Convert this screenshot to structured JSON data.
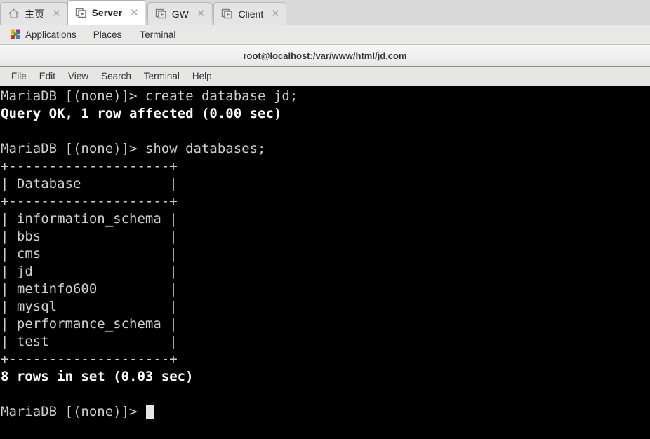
{
  "tabstrip": {
    "tabs": [
      {
        "label": "主页",
        "icon": "home-icon",
        "active": false,
        "close_label": "✕"
      },
      {
        "label": "Server",
        "icon": "window-play-icon",
        "active": true,
        "close_label": "✕"
      },
      {
        "label": "GW",
        "icon": "window-play-icon",
        "active": false,
        "close_label": "✕"
      },
      {
        "label": "Client",
        "icon": "window-play-icon",
        "active": false,
        "close_label": "✕"
      }
    ]
  },
  "gnome_panel": {
    "applications_label": "Applications",
    "places_label": "Places",
    "terminal_label": "Terminal"
  },
  "terminal": {
    "title": "root@localhost:/var/www/html/jd.com",
    "menu": [
      "File",
      "Edit",
      "View",
      "Search",
      "Terminal",
      "Help"
    ],
    "colors": {
      "background": "#000000",
      "foreground": "#cfcfcf",
      "bold_foreground": "#ffffff",
      "cursor": "#e6e6e6"
    },
    "lines": [
      {
        "text": "MariaDB [(none)]> create database jd;",
        "bold": false
      },
      {
        "text": "Query OK, 1 row affected (0.00 sec)",
        "bold": true
      },
      {
        "text": "",
        "bold": false
      },
      {
        "text": "MariaDB [(none)]> show databases;",
        "bold": false
      },
      {
        "text": "+--------------------+",
        "bold": false
      },
      {
        "text": "| Database           |",
        "bold": false
      },
      {
        "text": "+--------------------+",
        "bold": false
      },
      {
        "text": "| information_schema |",
        "bold": false
      },
      {
        "text": "| bbs                |",
        "bold": false
      },
      {
        "text": "| cms                |",
        "bold": false
      },
      {
        "text": "| jd                 |",
        "bold": false
      },
      {
        "text": "| metinfo600         |",
        "bold": false
      },
      {
        "text": "| mysql              |",
        "bold": false
      },
      {
        "text": "| performance_schema |",
        "bold": false
      },
      {
        "text": "| test               |",
        "bold": false
      },
      {
        "text": "+--------------------+",
        "bold": false
      },
      {
        "text": "8 rows in set (0.03 sec)",
        "bold": true
      },
      {
        "text": "",
        "bold": false
      },
      {
        "text": "MariaDB [(none)]> ",
        "bold": false,
        "cursor": true
      }
    ]
  }
}
